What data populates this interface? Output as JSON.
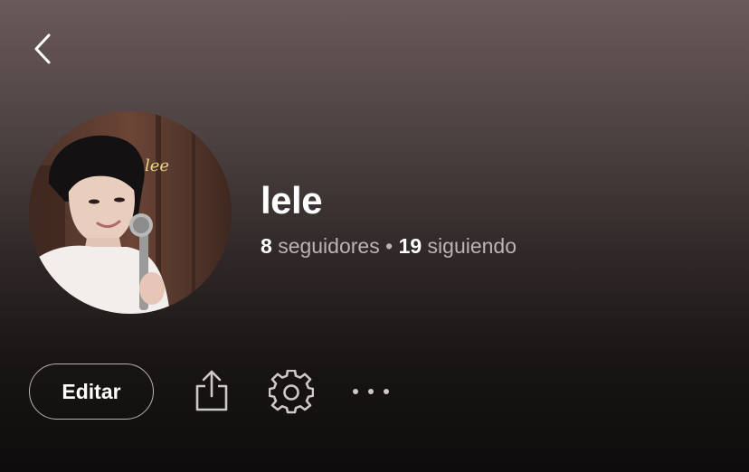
{
  "header": {
    "back_icon": "chevron-left-icon"
  },
  "profile": {
    "name": "lele",
    "followers_count": "8",
    "followers_label": "seguidores",
    "separator": "•",
    "following_count": "19",
    "following_label": "siguiendo",
    "avatar_signature": "lee"
  },
  "actions": {
    "edit_label": "Editar",
    "share_icon": "share-icon",
    "settings_icon": "gear-icon",
    "more_icon": "more-horizontal-icon"
  },
  "colors": {
    "gradient_top": "#6a5a5a",
    "gradient_bottom": "#0e0c0c",
    "text_primary": "#ffffff",
    "text_secondary": "#bcb3b3"
  }
}
